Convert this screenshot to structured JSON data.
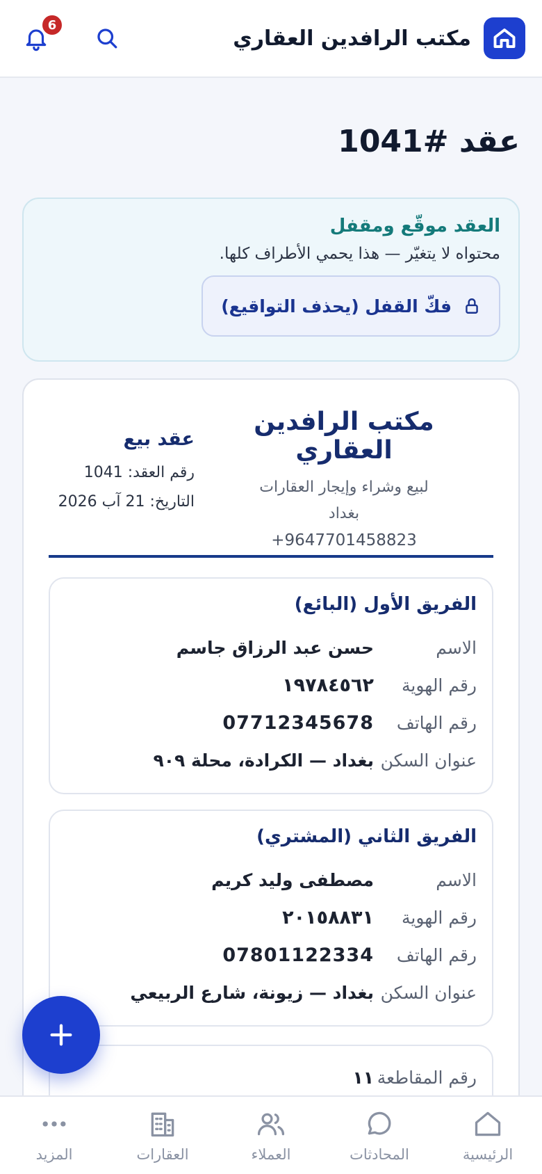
{
  "header": {
    "app_name": "مكتب الرافدين العقاري",
    "notifications_count": "6"
  },
  "page": {
    "title": "عقد #1041"
  },
  "lock_notice": {
    "title": "العقد موقّع ومقفل",
    "subtitle": "محتواه لا يتغيّر — هذا يحمي الأطراف كلها.",
    "unlock_label": "فكّ القفل (يحذف التواقيع)"
  },
  "contract": {
    "office_name": "مكتب الرافدين العقاري",
    "office_tagline": "لبيع وشراء وإيجار العقارات",
    "office_city": "بغداد",
    "office_phone": "+9647701458823",
    "type": "عقد بيع",
    "number_line": "رقم العقد: 1041",
    "date_line": "التاريخ: 21 آب 2026"
  },
  "party1": {
    "title": "الفريق الأول (البائع)",
    "name_label": "الاسم",
    "name": "حسن عبد الرزاق جاسم",
    "id_label": "رقم الهوية",
    "id": "١٩٧٨٤٥٦٢",
    "phone_label": "رقم الهاتف",
    "phone": "07712345678",
    "address_label": "عنوان السكن",
    "address": "بغداد — الكرادة، محلة ٩٠٩"
  },
  "party2": {
    "title": "الفريق الثاني (المشتري)",
    "name_label": "الاسم",
    "name": "مصطفى وليد كريم",
    "id_label": "رقم الهوية",
    "id": "٢٠١٥٨٨٣١",
    "phone_label": "رقم الهاتف",
    "phone": "07801122334",
    "address_label": "عنوان السكن",
    "address": "بغداد — زيونة، شارع الربيعي"
  },
  "property": {
    "plot_label": "رقم المقاطعة",
    "plot": "١١"
  },
  "nav": {
    "home": "الرئيسية",
    "chats": "المحادثات",
    "clients": "العملاء",
    "properties": "العقارات",
    "more": "المزيد"
  },
  "colors": {
    "primary": "#1d3fcf",
    "navy": "#162c6e",
    "teal": "#147a7a",
    "badge": "#c62828"
  }
}
